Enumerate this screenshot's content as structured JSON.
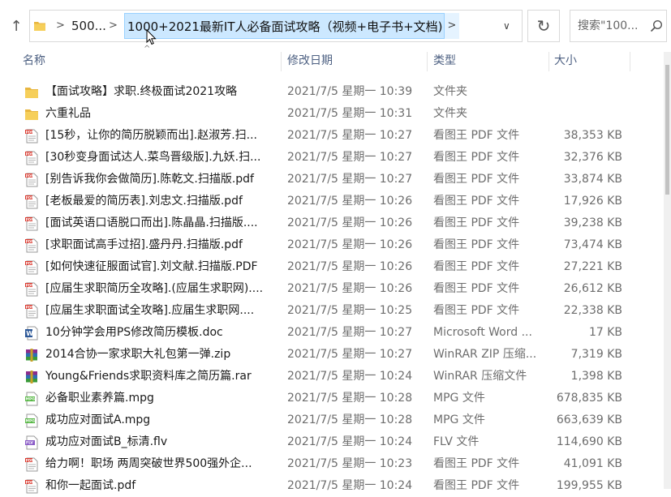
{
  "toolbar": {
    "up_symbol": "↑",
    "breadcrumb_short": "500...",
    "breadcrumb_current": "1000+2021最新IT人必备面试攻略（视频+电子书+文档)",
    "separator": ">",
    "refresh_symbol": "↻",
    "search_placeholder": "搜索\"100...",
    "dropdown_symbol": "∨"
  },
  "columns": {
    "name": "名称",
    "date": "修改日期",
    "type": "类型",
    "size": "大小"
  },
  "files": [
    {
      "icon": "folder-icon",
      "name": "【面试攻略】求职.终极面试2021攻略",
      "date": "2021/7/5 星期一 10:39",
      "type": "文件夹",
      "size": ""
    },
    {
      "icon": "folder-icon",
      "name": "六重礼品",
      "date": "2021/7/5 星期一 10:31",
      "type": "文件夹",
      "size": ""
    },
    {
      "icon": "pdf-icon",
      "name": "[15秒，让你的简历脱颖而出].赵淑芳.扫...",
      "date": "2021/7/5 星期一 10:27",
      "type": "看图王 PDF 文件",
      "size": "38,353 KB"
    },
    {
      "icon": "pdf-icon",
      "name": "[30秒变身面试达人.菜鸟晋级版].九妖.扫...",
      "date": "2021/7/5 星期一 10:27",
      "type": "看图王 PDF 文件",
      "size": "32,376 KB"
    },
    {
      "icon": "pdf-icon",
      "name": "[别告诉我你会做简历].陈乾文.扫描版.pdf",
      "date": "2021/7/5 星期一 10:27",
      "type": "看图王 PDF 文件",
      "size": "33,874 KB"
    },
    {
      "icon": "pdf-icon",
      "name": "[老板最爱的简历表].刘忠文.扫描版.pdf",
      "date": "2021/7/5 星期一 10:26",
      "type": "看图王 PDF 文件",
      "size": "17,926 KB"
    },
    {
      "icon": "pdf-icon",
      "name": "[面试英语口语脱口而出].陈晶晶.扫描版....",
      "date": "2021/7/5 星期一 10:26",
      "type": "看图王 PDF 文件",
      "size": "39,238 KB"
    },
    {
      "icon": "pdf-icon",
      "name": "[求职面试高手过招].盛丹丹.扫描版.pdf",
      "date": "2021/7/5 星期一 10:26",
      "type": "看图王 PDF 文件",
      "size": "73,474 KB"
    },
    {
      "icon": "pdf-icon",
      "name": "[如何快速征服面试官].刘文献.扫描版.PDF",
      "date": "2021/7/5 星期一 10:26",
      "type": "看图王 PDF 文件",
      "size": "27,221 KB"
    },
    {
      "icon": "pdf-icon",
      "name": "[应届生求职简历全攻略].(应届生求职网)....",
      "date": "2021/7/5 星期一 10:26",
      "type": "看图王 PDF 文件",
      "size": "26,612 KB"
    },
    {
      "icon": "pdf-icon",
      "name": "[应届生求职面试全攻略].应届生求职网....",
      "date": "2021/7/5 星期一 10:25",
      "type": "看图王 PDF 文件",
      "size": "22,338 KB"
    },
    {
      "icon": "word-icon",
      "name": "10分钟学会用PS修改简历模板.doc",
      "date": "2021/7/5 星期一 10:27",
      "type": "Microsoft Word ...",
      "size": "17 KB"
    },
    {
      "icon": "rar-icon",
      "name": "2014合协一家求职大礼包第一弹.zip",
      "date": "2021/7/5 星期一 10:27",
      "type": "WinRAR ZIP 压缩...",
      "size": "7,319 KB"
    },
    {
      "icon": "rar-icon",
      "name": "Young&Friends求职资料库之简历篇.rar",
      "date": "2021/7/5 星期一 10:24",
      "type": "WinRAR 压缩文件",
      "size": "1,398 KB"
    },
    {
      "icon": "mpg-icon",
      "name": "必备职业素养篇.mpg",
      "date": "2021/7/5 星期一 10:28",
      "type": "MPG 文件",
      "size": "678,835 KB"
    },
    {
      "icon": "mpg-icon",
      "name": "成功应对面试A.mpg",
      "date": "2021/7/5 星期一 10:28",
      "type": "MPG 文件",
      "size": "663,639 KB"
    },
    {
      "icon": "flv-icon",
      "name": "成功应对面试B_标清.flv",
      "date": "2021/7/5 星期一 10:24",
      "type": "FLV 文件",
      "size": "114,690 KB"
    },
    {
      "icon": "pdf-icon",
      "name": "给力啊！职场 两周突破世界500强外企...",
      "date": "2021/7/5 星期一 10:23",
      "type": "看图王 PDF 文件",
      "size": "41,091 KB"
    },
    {
      "icon": "pdf-icon",
      "name": "和你一起面试.pdf",
      "date": "2021/7/5 星期一 10:24",
      "type": "看图王 PDF 文件",
      "size": "199,955 KB"
    }
  ]
}
